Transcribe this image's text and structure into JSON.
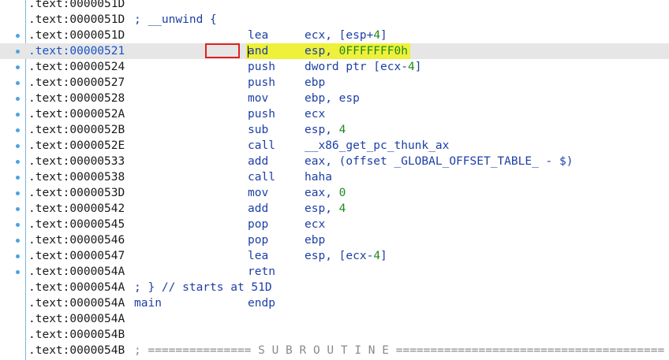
{
  "listing": {
    "rows": [
      {
        "addr": ".text:0000051D",
        "dot": false
      },
      {
        "addr": ".text:0000051D",
        "dot": false,
        "comment": "; __unwind {"
      },
      {
        "addr": ".text:0000051D",
        "dot": true,
        "mnem": "lea",
        "ops": [
          {
            "t": "ecx, [esp+"
          },
          {
            "t": "4",
            "num": true
          },
          {
            "t": "]"
          }
        ]
      },
      {
        "addr": ".text:00000521",
        "dot": true,
        "current": true,
        "mnem": "and",
        "ops": [
          {
            "t": "esp, "
          },
          {
            "t": "0FFFFFFF0h",
            "num": true
          }
        ]
      },
      {
        "addr": ".text:00000524",
        "dot": true,
        "mnem": "push",
        "ops": [
          {
            "t": "dword ptr [ecx-"
          },
          {
            "t": "4",
            "num": true
          },
          {
            "t": "]"
          }
        ]
      },
      {
        "addr": ".text:00000527",
        "dot": true,
        "mnem": "push",
        "ops": [
          {
            "t": "ebp"
          }
        ]
      },
      {
        "addr": ".text:00000528",
        "dot": true,
        "mnem": "mov",
        "ops": [
          {
            "t": "ebp, esp"
          }
        ]
      },
      {
        "addr": ".text:0000052A",
        "dot": true,
        "mnem": "push",
        "ops": [
          {
            "t": "ecx"
          }
        ]
      },
      {
        "addr": ".text:0000052B",
        "dot": true,
        "mnem": "sub",
        "ops": [
          {
            "t": "esp, "
          },
          {
            "t": "4",
            "num": true
          }
        ]
      },
      {
        "addr": ".text:0000052E",
        "dot": true,
        "mnem": "call",
        "ops": [
          {
            "t": "__x86_get_pc_thunk_ax"
          }
        ]
      },
      {
        "addr": ".text:00000533",
        "dot": true,
        "mnem": "add",
        "ops": [
          {
            "t": "eax, (offset _GLOBAL_OFFSET_TABLE_ - $)"
          }
        ]
      },
      {
        "addr": ".text:00000538",
        "dot": true,
        "mnem": "call",
        "ops": [
          {
            "t": "haha"
          }
        ]
      },
      {
        "addr": ".text:0000053D",
        "dot": true,
        "mnem": "mov",
        "ops": [
          {
            "t": "eax, "
          },
          {
            "t": "0",
            "num": true
          }
        ]
      },
      {
        "addr": ".text:00000542",
        "dot": true,
        "mnem": "add",
        "ops": [
          {
            "t": "esp, "
          },
          {
            "t": "4",
            "num": true
          }
        ]
      },
      {
        "addr": ".text:00000545",
        "dot": true,
        "mnem": "pop",
        "ops": [
          {
            "t": "ecx"
          }
        ]
      },
      {
        "addr": ".text:00000546",
        "dot": true,
        "mnem": "pop",
        "ops": [
          {
            "t": "ebp"
          }
        ]
      },
      {
        "addr": ".text:00000547",
        "dot": true,
        "mnem": "lea",
        "ops": [
          {
            "t": "esp, [ecx-"
          },
          {
            "t": "4",
            "num": true
          },
          {
            "t": "]"
          }
        ]
      },
      {
        "addr": ".text:0000054A",
        "dot": true,
        "mnem": "retn",
        "ops": []
      },
      {
        "addr": ".text:0000054A",
        "dot": false,
        "comment": "; } // starts at 51D"
      },
      {
        "addr": ".text:0000054A",
        "dot": false,
        "label": "main",
        "mnem": "endp",
        "ops": []
      },
      {
        "addr": ".text:0000054A",
        "dot": false
      },
      {
        "addr": ".text:0000054B",
        "dot": false
      },
      {
        "addr": ".text:0000054B",
        "dot": false,
        "subroutine": "; =============== S U B R O U T I N E ======================================="
      }
    ]
  },
  "colors": {
    "highlight": "#eef03a",
    "current_line": "#e6e6e6",
    "annotation_box": "#e02020",
    "numbers": "#1f8a1f",
    "instructions": "#1d3fa6"
  }
}
